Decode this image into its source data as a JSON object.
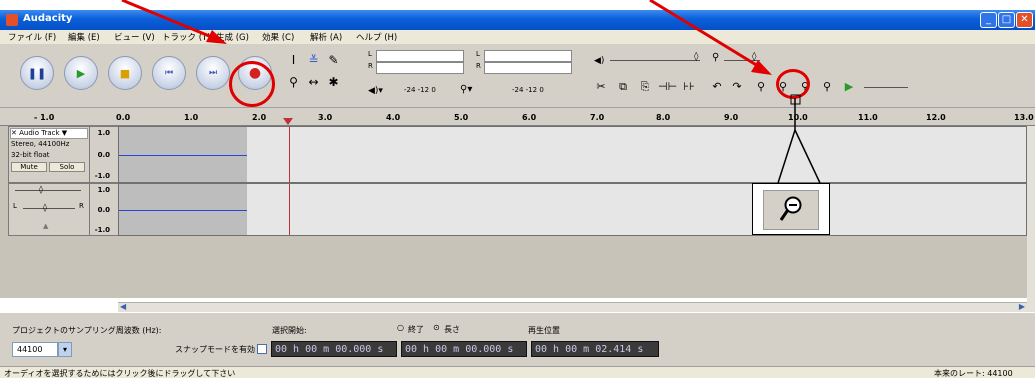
{
  "window": {
    "title": "Audacity",
    "controls": [
      "minimize-icon",
      "maximize-icon",
      "close-icon"
    ]
  },
  "menu": [
    "ファイル (F)",
    "編集 (E)",
    "ビュー (V)",
    "トラック (T)",
    "生成 (G)",
    "効果 (C)",
    "解析 (A)",
    "ヘルプ (H)"
  ],
  "meters": {
    "playback_scale": "-24 -12 0",
    "record_scale": "-24 -12 0",
    "left": "L",
    "right": "R"
  },
  "ruler": [
    "- 1.0",
    "0.0",
    "1.0",
    "2.0",
    "3.0",
    "4.0",
    "5.0",
    "6.0",
    "7.0",
    "8.0",
    "9.0",
    "10.0",
    "11.0",
    "12.0",
    "13.0"
  ],
  "track": {
    "name": "Audio Track",
    "info1": "Stereo, 44100Hz",
    "info2": "32-bit float",
    "mute": "Mute",
    "solo": "Solo",
    "pan_left": "L",
    "pan_right": "R",
    "scale": [
      "1.0",
      "0.0",
      "-1.0"
    ]
  },
  "selection": {
    "rate_label": "プロジェクトのサンプリング周波数 (Hz):",
    "rate_value": "44100",
    "snap_label": "スナップモードを有効",
    "start_label": "選択開始:",
    "end_label": "終了",
    "length_label": "長さ",
    "start_time": "00 h 00 m 00.000 s",
    "end_time": "00 h 00 m 00.000 s",
    "playpos_label": "再生位置",
    "playpos_time": "00 h 00 m 02.414 s"
  },
  "status": {
    "hint": "オーディオを選択するためにはクリック後にドラッグして下さい",
    "rate": "本来のレート: 44100"
  },
  "colors": {
    "annotation": "#e00000",
    "waveform": "#2c44d6",
    "cursor": "#c0303a",
    "titlebar": "#0a5fd8"
  }
}
